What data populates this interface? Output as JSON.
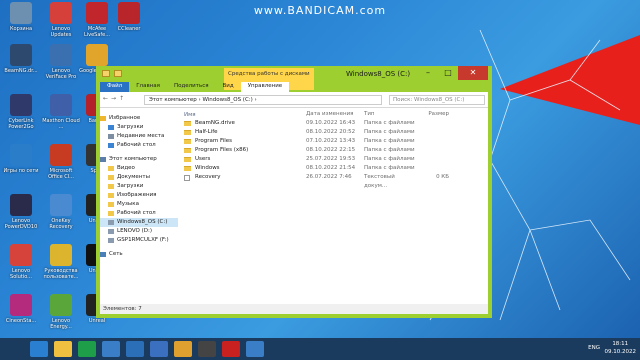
{
  "watermark": "www.BANDICAM.com",
  "desktop_icons": [
    {
      "label": "Корзина",
      "color": "#6d8fb0"
    },
    {
      "label": "Lenovo Updates",
      "color": "#d5413a"
    },
    {
      "label": "McAfee LiveSafe...",
      "color": "#c0262c"
    },
    {
      "label": "CCleaner",
      "color": "#b8252a"
    },
    {
      "label": "BeamNG.dr...",
      "color": "#2d4a6e"
    },
    {
      "label": "Lenovo VeriFace Pro",
      "color": "#3a6fb0"
    },
    {
      "label": "Google Chrom",
      "color": "#e2a52b"
    },
    {
      "label": "CyberLink Power2Go",
      "color": "#2f3a6b"
    },
    {
      "label": "Maxthon Cloud ...",
      "color": "#3f5fa8"
    },
    {
      "label": "Bandic",
      "color": "#b3212a"
    },
    {
      "label": "Игры по сети",
      "color": "#2a7dc9"
    },
    {
      "label": "Microsoft Office Cl...",
      "color": "#c63b22"
    },
    {
      "label": "Spinr",
      "color": "#333"
    },
    {
      "label": "Lenovo PowerDVD10",
      "color": "#2a2a4a"
    },
    {
      "label": "OneKey Recovery",
      "color": "#4a8ad1"
    },
    {
      "label": "Unreal",
      "color": "#222"
    },
    {
      "label": "Lenovo Solutio...",
      "color": "#d5433a"
    },
    {
      "label": "Руководства пользовате...",
      "color": "#dcb42e"
    },
    {
      "label": "Unreal",
      "color": "#111"
    },
    {
      "label": "CineonSta...",
      "color": "#b42a7d"
    },
    {
      "label": "Lenovo Energy...",
      "color": "#5aa63a"
    },
    {
      "label": "Unreal",
      "color": "#222"
    }
  ],
  "window": {
    "title": "Windows8_OS (C:)",
    "context_tab": "Средства работы с дисками",
    "ribbon_tabs": [
      "Файл",
      "Главная",
      "Поделиться",
      "Вид",
      "Управление"
    ],
    "address": "Этот компьютер  ›  Windows8_OS (C:)  ›",
    "search_placeholder": "Поиск: Windows8_OS (C:)",
    "columns": {
      "name": "Имя",
      "date": "Дата изменения",
      "type": "Тип",
      "size": "Размер"
    },
    "files": [
      {
        "name": "BeamNG.drive",
        "date": "09.10.2022 16:43",
        "type": "Папка с файлами",
        "size": "",
        "kind": "folder"
      },
      {
        "name": "Half-Life",
        "date": "08.10.2022 20:52",
        "type": "Папка с файлами",
        "size": "",
        "kind": "folder"
      },
      {
        "name": "Program Files",
        "date": "07.10.2022 13:43",
        "type": "Папка с файлами",
        "size": "",
        "kind": "folder"
      },
      {
        "name": "Program Files (x86)",
        "date": "08.10.2022 22:15",
        "type": "Папка с файлами",
        "size": "",
        "kind": "folder"
      },
      {
        "name": "Users",
        "date": "25.07.2022 19:53",
        "type": "Папка с файлами",
        "size": "",
        "kind": "folder"
      },
      {
        "name": "Windows",
        "date": "08.10.2022 21:54",
        "type": "Папка с файлами",
        "size": "",
        "kind": "folder"
      },
      {
        "name": "Recovery",
        "date": "26.07.2022 7:46",
        "type": "Текстовый докум...",
        "size": "0 КБ",
        "kind": "file"
      }
    ],
    "nav": {
      "favorites": "Избранное",
      "fav_items": [
        "Загрузки",
        "Недавние места",
        "Рабочий стол"
      ],
      "computer": "Этот компьютер",
      "comp_items": [
        "Видео",
        "Документы",
        "Загрузки",
        "Изображения",
        "Музыка",
        "Рабочий стол"
      ],
      "drives": [
        "Windows8_OS (C:)",
        "LENOVO (D:)",
        "GSP1RMCULXF (F:)"
      ],
      "network": "Сеть"
    },
    "status": "Элементов: 7"
  },
  "taskbar": {
    "icons": [
      "start",
      "ie",
      "explorer",
      "store",
      "monitor",
      "photo",
      "maxthon",
      "chrome",
      "unknown",
      "record",
      "explorer2"
    ],
    "lang": "ENG",
    "time": "18:11",
    "date": "09.10.2022"
  }
}
